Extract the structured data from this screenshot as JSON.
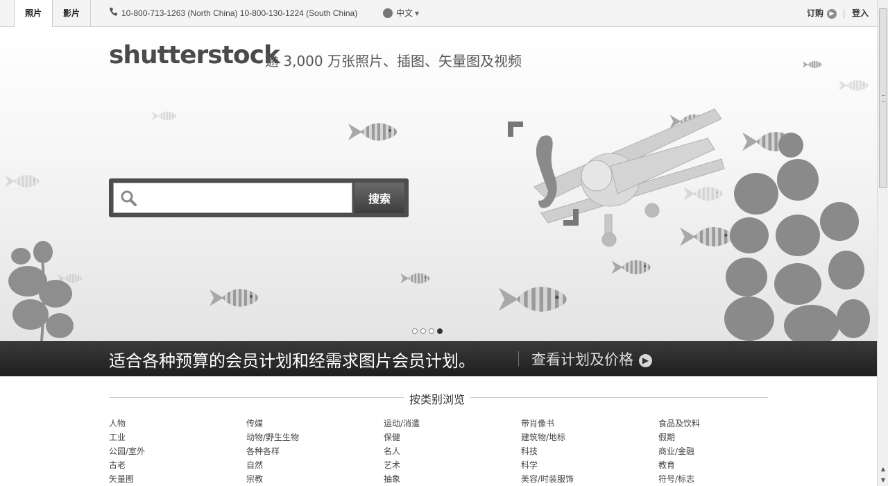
{
  "topbar": {
    "tabs": [
      {
        "label": "照片",
        "active": true
      },
      {
        "label": "影片",
        "active": false
      }
    ],
    "phone_icon": "phone-icon",
    "phone": "10-800-713-1263 (North China) 10-800-130-1224 (South China)",
    "language": "中文",
    "subscribe_label": "订购",
    "login_label": "登入"
  },
  "hero": {
    "logo": "shutterstock",
    "tagline": "逾 3,000 万张照片、插图、矢量图及视频",
    "search": {
      "placeholder": "",
      "value": "",
      "button_label": "搜索"
    },
    "slides_count": 4,
    "active_slide": 4
  },
  "promo": {
    "text": "适合各种预算的会员计划和经需求图片会员计划。",
    "link_label": "查看计划及价格"
  },
  "browse": {
    "title": "按类别浏览",
    "columns": [
      [
        "人物",
        "工业",
        "公园/室外",
        "古老",
        "矢量图"
      ],
      [
        "传媒",
        "动物/野生生物",
        "各种各样",
        "自然",
        "宗教"
      ],
      [
        "运动/消遣",
        "保健",
        "名人",
        "艺术",
        "抽象"
      ],
      [
        "带肖像书",
        "建筑物/地标",
        "科技",
        "科学",
        "美容/时装服饰"
      ],
      [
        "食品及饮料",
        "假期",
        "商业/金融",
        "教育",
        "符号/标志"
      ]
    ]
  },
  "colors": {
    "promo_bg": "#2b2b2b",
    "search_frame": "#4d4d4d",
    "fish_stripe": "#8c8c8c"
  }
}
